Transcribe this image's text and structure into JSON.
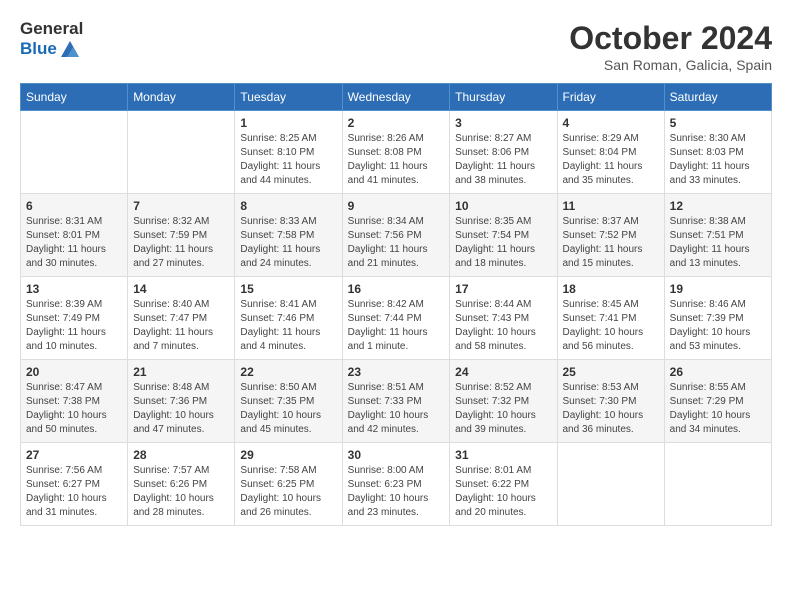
{
  "logo": {
    "general": "General",
    "blue": "Blue"
  },
  "header": {
    "month": "October 2024",
    "location": "San Roman, Galicia, Spain"
  },
  "days_of_week": [
    "Sunday",
    "Monday",
    "Tuesday",
    "Wednesday",
    "Thursday",
    "Friday",
    "Saturday"
  ],
  "weeks": [
    [
      {
        "day": "",
        "detail": ""
      },
      {
        "day": "",
        "detail": ""
      },
      {
        "day": "1",
        "detail": "Sunrise: 8:25 AM\nSunset: 8:10 PM\nDaylight: 11 hours and 44 minutes."
      },
      {
        "day": "2",
        "detail": "Sunrise: 8:26 AM\nSunset: 8:08 PM\nDaylight: 11 hours and 41 minutes."
      },
      {
        "day": "3",
        "detail": "Sunrise: 8:27 AM\nSunset: 8:06 PM\nDaylight: 11 hours and 38 minutes."
      },
      {
        "day": "4",
        "detail": "Sunrise: 8:29 AM\nSunset: 8:04 PM\nDaylight: 11 hours and 35 minutes."
      },
      {
        "day": "5",
        "detail": "Sunrise: 8:30 AM\nSunset: 8:03 PM\nDaylight: 11 hours and 33 minutes."
      }
    ],
    [
      {
        "day": "6",
        "detail": "Sunrise: 8:31 AM\nSunset: 8:01 PM\nDaylight: 11 hours and 30 minutes."
      },
      {
        "day": "7",
        "detail": "Sunrise: 8:32 AM\nSunset: 7:59 PM\nDaylight: 11 hours and 27 minutes."
      },
      {
        "day": "8",
        "detail": "Sunrise: 8:33 AM\nSunset: 7:58 PM\nDaylight: 11 hours and 24 minutes."
      },
      {
        "day": "9",
        "detail": "Sunrise: 8:34 AM\nSunset: 7:56 PM\nDaylight: 11 hours and 21 minutes."
      },
      {
        "day": "10",
        "detail": "Sunrise: 8:35 AM\nSunset: 7:54 PM\nDaylight: 11 hours and 18 minutes."
      },
      {
        "day": "11",
        "detail": "Sunrise: 8:37 AM\nSunset: 7:52 PM\nDaylight: 11 hours and 15 minutes."
      },
      {
        "day": "12",
        "detail": "Sunrise: 8:38 AM\nSunset: 7:51 PM\nDaylight: 11 hours and 13 minutes."
      }
    ],
    [
      {
        "day": "13",
        "detail": "Sunrise: 8:39 AM\nSunset: 7:49 PM\nDaylight: 11 hours and 10 minutes."
      },
      {
        "day": "14",
        "detail": "Sunrise: 8:40 AM\nSunset: 7:47 PM\nDaylight: 11 hours and 7 minutes."
      },
      {
        "day": "15",
        "detail": "Sunrise: 8:41 AM\nSunset: 7:46 PM\nDaylight: 11 hours and 4 minutes."
      },
      {
        "day": "16",
        "detail": "Sunrise: 8:42 AM\nSunset: 7:44 PM\nDaylight: 11 hours and 1 minute."
      },
      {
        "day": "17",
        "detail": "Sunrise: 8:44 AM\nSunset: 7:43 PM\nDaylight: 10 hours and 58 minutes."
      },
      {
        "day": "18",
        "detail": "Sunrise: 8:45 AM\nSunset: 7:41 PM\nDaylight: 10 hours and 56 minutes."
      },
      {
        "day": "19",
        "detail": "Sunrise: 8:46 AM\nSunset: 7:39 PM\nDaylight: 10 hours and 53 minutes."
      }
    ],
    [
      {
        "day": "20",
        "detail": "Sunrise: 8:47 AM\nSunset: 7:38 PM\nDaylight: 10 hours and 50 minutes."
      },
      {
        "day": "21",
        "detail": "Sunrise: 8:48 AM\nSunset: 7:36 PM\nDaylight: 10 hours and 47 minutes."
      },
      {
        "day": "22",
        "detail": "Sunrise: 8:50 AM\nSunset: 7:35 PM\nDaylight: 10 hours and 45 minutes."
      },
      {
        "day": "23",
        "detail": "Sunrise: 8:51 AM\nSunset: 7:33 PM\nDaylight: 10 hours and 42 minutes."
      },
      {
        "day": "24",
        "detail": "Sunrise: 8:52 AM\nSunset: 7:32 PM\nDaylight: 10 hours and 39 minutes."
      },
      {
        "day": "25",
        "detail": "Sunrise: 8:53 AM\nSunset: 7:30 PM\nDaylight: 10 hours and 36 minutes."
      },
      {
        "day": "26",
        "detail": "Sunrise: 8:55 AM\nSunset: 7:29 PM\nDaylight: 10 hours and 34 minutes."
      }
    ],
    [
      {
        "day": "27",
        "detail": "Sunrise: 7:56 AM\nSunset: 6:27 PM\nDaylight: 10 hours and 31 minutes."
      },
      {
        "day": "28",
        "detail": "Sunrise: 7:57 AM\nSunset: 6:26 PM\nDaylight: 10 hours and 28 minutes."
      },
      {
        "day": "29",
        "detail": "Sunrise: 7:58 AM\nSunset: 6:25 PM\nDaylight: 10 hours and 26 minutes."
      },
      {
        "day": "30",
        "detail": "Sunrise: 8:00 AM\nSunset: 6:23 PM\nDaylight: 10 hours and 23 minutes."
      },
      {
        "day": "31",
        "detail": "Sunrise: 8:01 AM\nSunset: 6:22 PM\nDaylight: 10 hours and 20 minutes."
      },
      {
        "day": "",
        "detail": ""
      },
      {
        "day": "",
        "detail": ""
      }
    ]
  ]
}
